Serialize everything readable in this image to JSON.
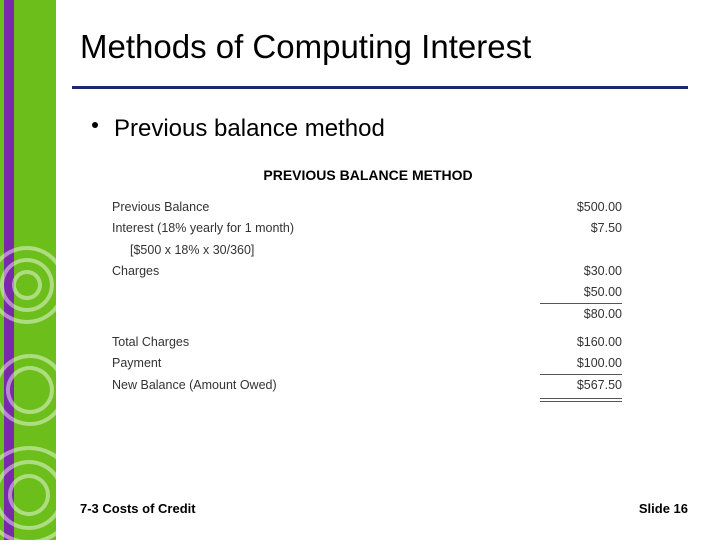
{
  "title": "Methods of Computing Interest",
  "bullet": "Previous balance method",
  "table": {
    "header": "PREVIOUS BALANCE METHOD",
    "rows": [
      {
        "label": "Previous Balance",
        "value": "$500.00"
      },
      {
        "label": "Interest (18% yearly for 1 month)",
        "value": "$7.50"
      },
      {
        "label": "[$500 x 18% x 30/360]",
        "value": "",
        "indent": true
      },
      {
        "label": "Charges",
        "value": "$30.00"
      },
      {
        "label": "",
        "value": "$50.00"
      },
      {
        "label": "",
        "value": "$80.00",
        "ruleBefore": true
      }
    ],
    "totals": [
      {
        "label": "Total Charges",
        "value": "$160.00"
      },
      {
        "label": "Payment",
        "value": "$100.00"
      },
      {
        "label": "New Balance (Amount Owed)",
        "value": "$567.50",
        "ruleBefore": true,
        "doubleRuleAfter": true
      }
    ]
  },
  "footer": {
    "left": "7-3 Costs of Credit",
    "right": "Slide 16"
  }
}
